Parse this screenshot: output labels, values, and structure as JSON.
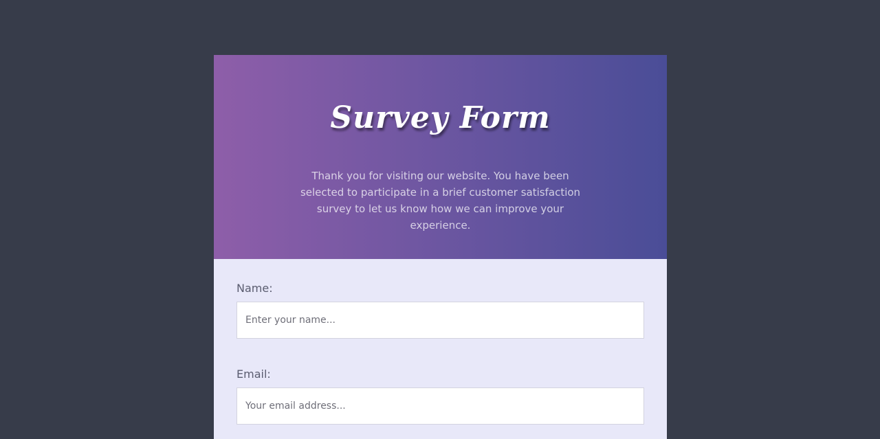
{
  "header": {
    "title": "Survey Form",
    "description": "Thank you for visiting our website. You have been selected to participate in a brief customer satisfaction survey to let us know how we can improve your experience."
  },
  "form": {
    "name": {
      "label": "Name:",
      "placeholder": "Enter your name...",
      "value": ""
    },
    "email": {
      "label": "Email:",
      "placeholder": "Your email address...",
      "value": ""
    }
  },
  "colors": {
    "page_background": "#373c4a",
    "header_gradient_start": "#8e5ea9",
    "header_gradient_end": "#4a4d97",
    "form_background": "#e8e8f9"
  }
}
